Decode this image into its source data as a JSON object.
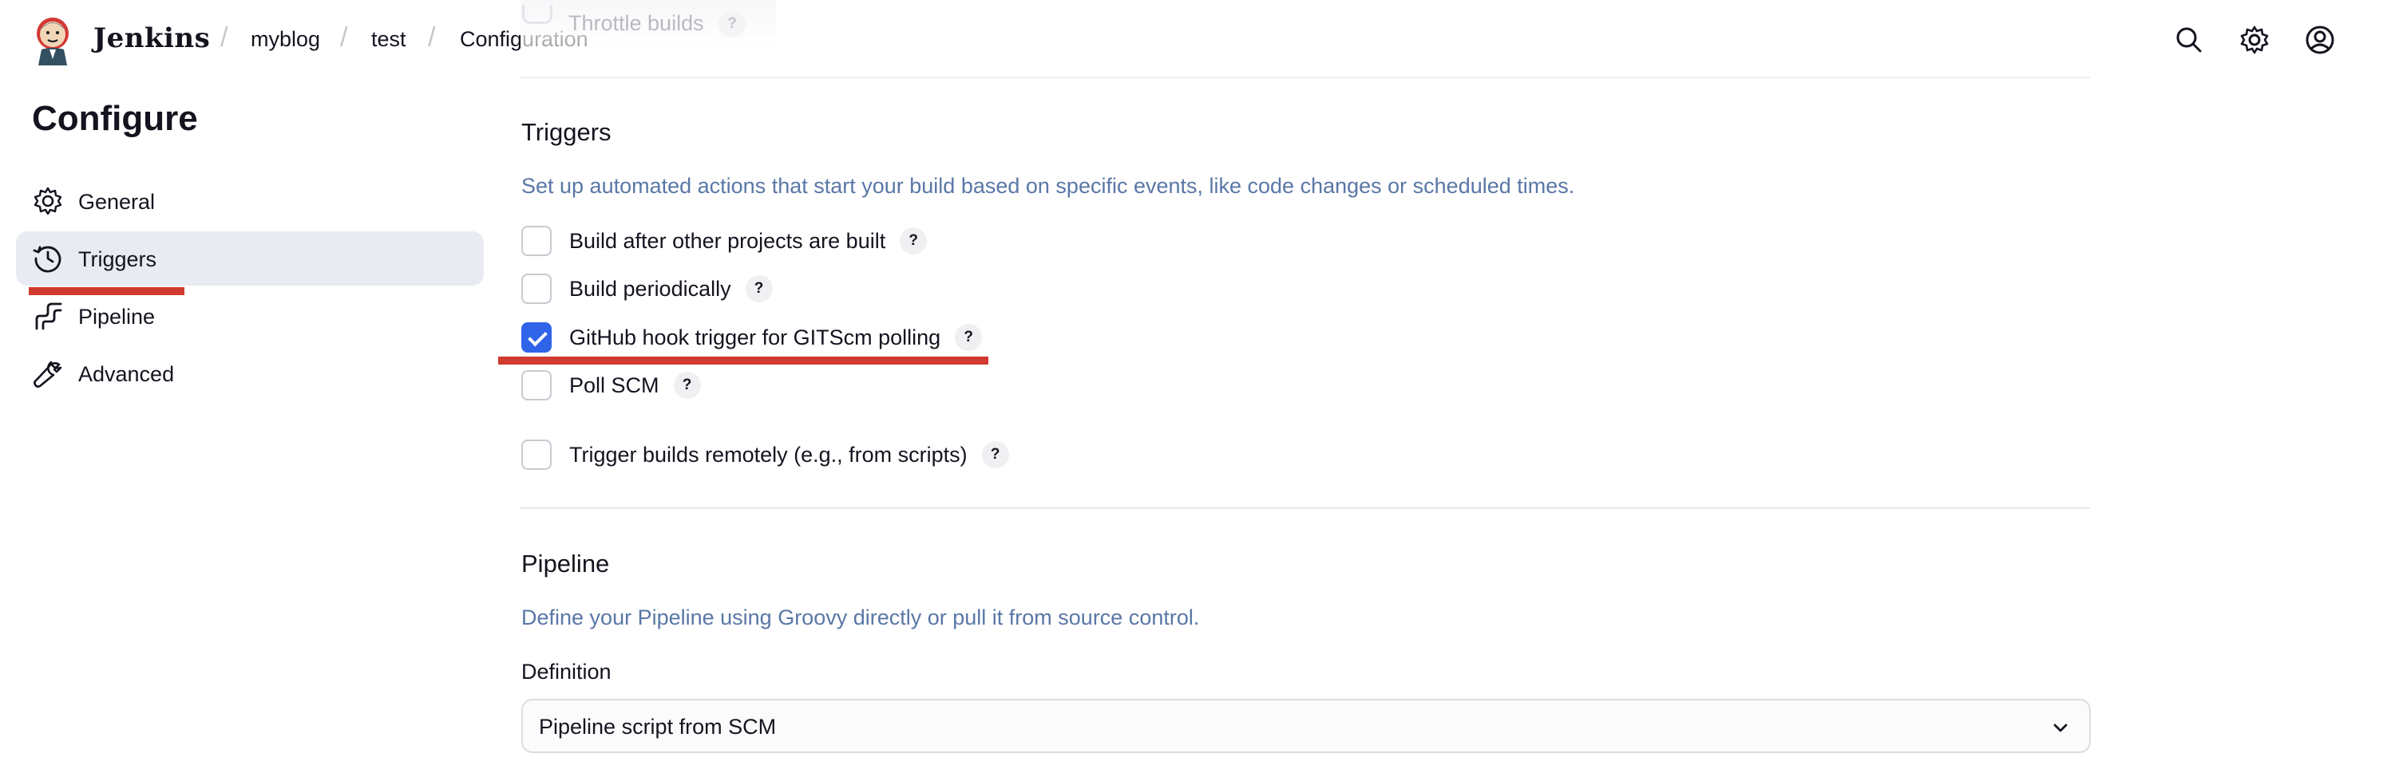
{
  "header": {
    "brand": "Jenkins",
    "breadcrumbs": [
      "myblog",
      "test",
      "Configuration"
    ],
    "icons": [
      "search-icon",
      "gear-icon",
      "user-icon"
    ]
  },
  "ghost": {
    "label": "Throttle builds",
    "help": "?"
  },
  "sidebar": {
    "title": "Configure",
    "items": [
      {
        "label": "General",
        "icon": "gear-icon",
        "active": false
      },
      {
        "label": "Triggers",
        "icon": "clock-icon",
        "active": true
      },
      {
        "label": "Pipeline",
        "icon": "pipeline-icon",
        "active": false
      },
      {
        "label": "Advanced",
        "icon": "wrench-icon",
        "active": false
      }
    ]
  },
  "triggers": {
    "title": "Triggers",
    "description": "Set up automated actions that start your build based on specific events, like code changes or scheduled times.",
    "options": [
      {
        "label": "Build after other projects are built",
        "checked": false,
        "help": "?"
      },
      {
        "label": "Build periodically",
        "checked": false,
        "help": "?"
      },
      {
        "label": "GitHub hook trigger for GITScm polling",
        "checked": true,
        "help": "?"
      },
      {
        "label": "Poll SCM",
        "checked": false,
        "help": "?"
      },
      {
        "label": "Trigger builds remotely (e.g., from scripts)",
        "checked": false,
        "help": "?"
      }
    ]
  },
  "pipeline": {
    "title": "Pipeline",
    "description": "Define your Pipeline using Groovy directly or pull it from source control.",
    "definition_label": "Definition",
    "definition_value": "Pipeline script from SCM"
  },
  "colors": {
    "accent": "#2f63e8",
    "annotation": "#d03a2f",
    "description": "#5a77a6",
    "active_bg": "#e9ebf2"
  }
}
